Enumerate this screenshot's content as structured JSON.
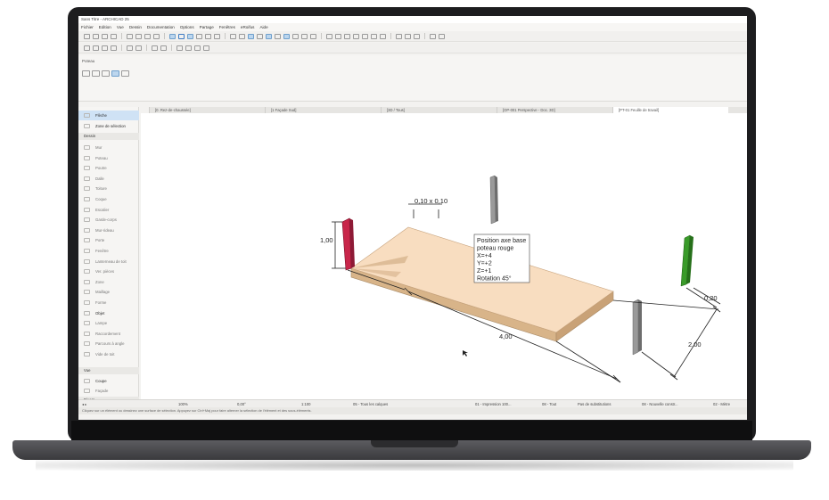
{
  "window": {
    "title": "Sans Titre - ARCHICAD 25"
  },
  "menu": [
    "Fichier",
    "Edition",
    "Vue",
    "Dessin",
    "Documentation",
    "Options",
    "Partage",
    "Fenêtres",
    "eRoifus",
    "Aide"
  ],
  "info_box": {
    "label": "Poteau"
  },
  "tabs": [
    {
      "label": "[0. Rez-de-chaussée]"
    },
    {
      "label": "[1 Façade Sud]"
    },
    {
      "label": "[3D / Tous]"
    },
    {
      "label": "[OP-001 Perspective - Doc. 3D]"
    },
    {
      "label": "[PT-01 Feuille de travail]"
    }
  ],
  "toolbox": {
    "pointer": "Flèche",
    "marquee": "Zone de sélection",
    "design_header": "Dessin",
    "tools": [
      "Mur",
      "Poteau",
      "Poutre",
      "Dalle",
      "Toiture",
      "Coque",
      "Escalier",
      "Garde-corps",
      "Mur-rideau",
      "Porte",
      "Fenêtre",
      "Lanterneau de toit",
      "Ver. pièces",
      "Zone",
      "Maillage",
      "Forme",
      "Objet",
      "Lampe",
      "Raccordement",
      "Parcours à angle",
      "Vide de toit"
    ],
    "view_header": "Vue",
    "section": "Coupe",
    "facade": "Façade",
    "other": "Divers"
  },
  "viewport": {
    "tooltip": [
      "Position axe base",
      "poteau rouge",
      "X=+4",
      "Y=+2",
      "Z=+1",
      "Rotation 45°"
    ],
    "dimensions": {
      "post_section": "0,10 x 0,10",
      "height": "1,00",
      "length": "4,00",
      "width": "2,00",
      "thickness": "0,20"
    },
    "colors": {
      "slab_top": "#f8ddc0",
      "slab_side": "#d8b489",
      "post_red": "#c8264a",
      "post_green": "#3a9b2a",
      "post_grey": "#8e8e8e"
    }
  },
  "statusbar": {
    "zoom": "100%",
    "angle": "0,00°",
    "scale": "1:100",
    "layer": "05 - Tous les calques",
    "print": "01 - Impression 100...",
    "fill": "08 - Tout",
    "substitution": "Pas de substitutions",
    "renovation": "08 - Nouvelle constr...",
    "unit": "02 - Mètre"
  },
  "hint": "Cliquez sur un élément ou dessinez une surface de sélection. Appuyez sur Ctrl+Maj pour faire alterner la sélection de l'élément et des sous-éléments."
}
